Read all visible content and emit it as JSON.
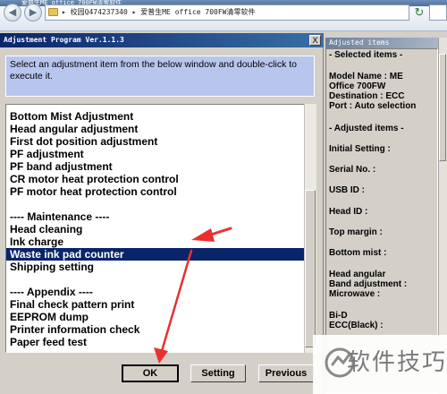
{
  "window": {
    "title": "爱普生ME office 700FW清零软件"
  },
  "explorer": {
    "address": "▸ 校园Q474237340 ▸ 爱普生ME office 700FW清零软件"
  },
  "main": {
    "title": "Adjustment Program Ver.1.1.3",
    "close_label": "X",
    "instructions": "Select an adjustment item from the below window and double-click to execute it.",
    "list": [
      {
        "label": "Bottom Mist Adjustment",
        "selected": false
      },
      {
        "label": "Head angular adjustment",
        "selected": false
      },
      {
        "label": "First dot position adjustment",
        "selected": false
      },
      {
        "label": "PF adjustment",
        "selected": false
      },
      {
        "label": "PF band adjustment",
        "selected": false
      },
      {
        "label": "CR motor heat protection control",
        "selected": false
      },
      {
        "label": "PF motor heat protection control",
        "selected": false
      },
      {
        "label": "",
        "selected": false
      },
      {
        "label": "---- Maintenance ----",
        "selected": false
      },
      {
        "label": "Head cleaning",
        "selected": false
      },
      {
        "label": "Ink charge",
        "selected": false
      },
      {
        "label": "Waste ink pad counter",
        "selected": true
      },
      {
        "label": "Shipping setting",
        "selected": false
      },
      {
        "label": "",
        "selected": false
      },
      {
        "label": "---- Appendix ----",
        "selected": false
      },
      {
        "label": "Final check pattern print",
        "selected": false
      },
      {
        "label": "EEPROM dump",
        "selected": false
      },
      {
        "label": "Printer information check",
        "selected": false
      },
      {
        "label": "Paper feed test",
        "selected": false
      }
    ],
    "buttons": {
      "ok": "OK",
      "setting": "Setting",
      "previous": "Previous"
    }
  },
  "side": {
    "title": "Adjusted items",
    "selected_header": "- Selected items -",
    "model_name": "Model Name : ME",
    "model_name_2": "Office 700FW",
    "destination": "Destination : ECC",
    "port": "Port : Auto selection",
    "adjusted_header": "- Adjusted items -",
    "initial_setting": "Initial Setting :",
    "serial_no": "Serial No. :",
    "usb_id": "USB ID :",
    "head_id": "Head ID :",
    "top_margin": "Top margin :",
    "bottom_mist": "Bottom mist :",
    "head_angular": "Head angular",
    "band_adjustment": " Band adjustment :",
    "microwave": " Microwave :",
    "bi_d": "Bi-D",
    "ecc_black": " ECC(Black) :"
  },
  "watermark": {
    "text": "软件技巧"
  },
  "colors": {
    "selection": "#0a246a",
    "instruction_bg": "#b8c6ee",
    "arrow": "#e8312f"
  }
}
